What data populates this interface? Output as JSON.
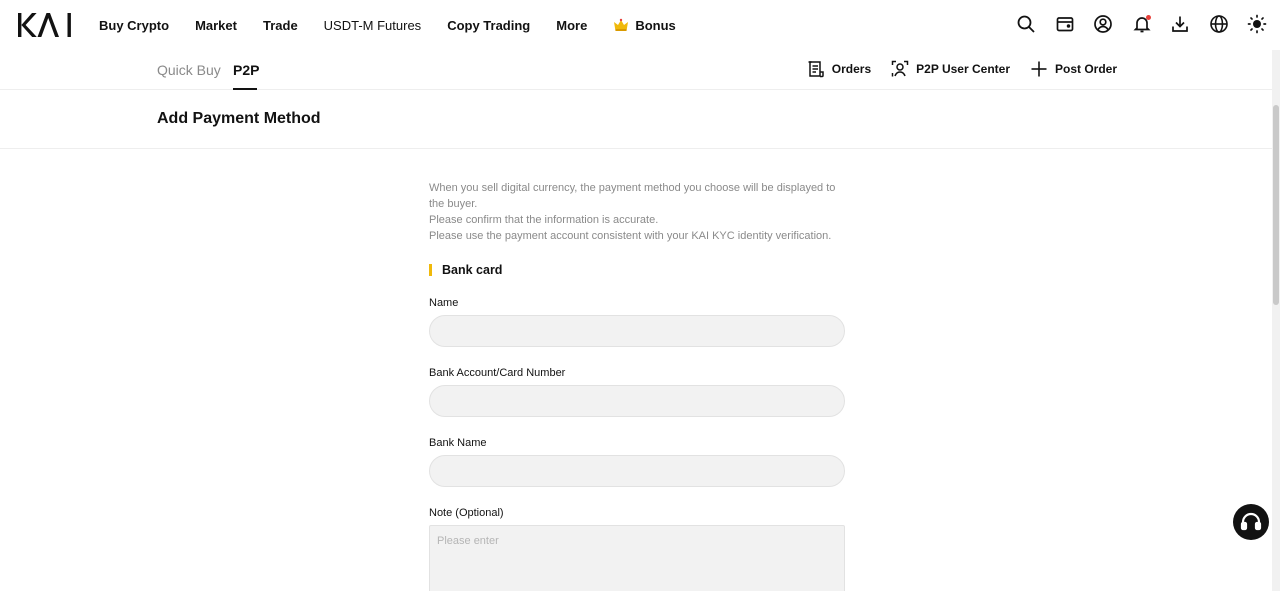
{
  "brand": {
    "logo_text": "KAI"
  },
  "topnav": {
    "items": [
      {
        "label": "Buy Crypto"
      },
      {
        "label": "Market"
      },
      {
        "label": "Trade"
      },
      {
        "label": "USDT-M Futures"
      },
      {
        "label": "Copy Trading"
      },
      {
        "label": "More"
      }
    ],
    "bonus_label": "Bonus",
    "icons": [
      "search-icon",
      "wallet-icon",
      "account-icon",
      "bell-icon",
      "download-icon",
      "globe-icon",
      "theme-sun-icon"
    ]
  },
  "subnav": {
    "tabs": [
      {
        "label": "Quick Buy",
        "active": false
      },
      {
        "label": "P2P",
        "active": true
      }
    ],
    "actions": [
      {
        "label": "Orders",
        "icon": "orders-icon"
      },
      {
        "label": "P2P User Center",
        "icon": "user-center-icon"
      },
      {
        "label": "Post Order",
        "icon": "plus-icon"
      }
    ]
  },
  "page": {
    "title": "Add Payment Method"
  },
  "form": {
    "notice": [
      "When you sell digital currency, the payment method you choose will be displayed to the buyer.",
      "Please confirm that the information is accurate.",
      "Please use the payment account consistent with your KAI KYC identity verification."
    ],
    "section_title": "Bank card",
    "fields": {
      "name": {
        "label": "Name",
        "value": ""
      },
      "account": {
        "label": "Bank Account/Card Number",
        "value": ""
      },
      "bank": {
        "label": "Bank Name",
        "value": ""
      },
      "note": {
        "label": "Note (Optional)",
        "placeholder": "Please enter",
        "value": ""
      }
    }
  },
  "colors": {
    "accent": "#f0b90b",
    "notification": "#e8413b",
    "input_bg": "#f2f2f2"
  },
  "support": {
    "icon": "headset-icon"
  }
}
